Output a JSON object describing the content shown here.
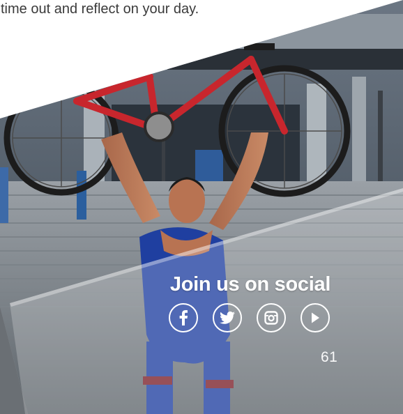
{
  "intro_text": "time out and reflect on your day.",
  "social": {
    "title": "Join us on social",
    "icons": [
      "facebook-icon",
      "twitter-icon",
      "instagram-icon",
      "play-icon"
    ]
  },
  "page_number": "61",
  "colors": {
    "text_dark": "#3a3a3a",
    "overlay_white": "#ffffff",
    "bike_red": "#c8262d",
    "kit_blue": "#1f3fa0"
  }
}
